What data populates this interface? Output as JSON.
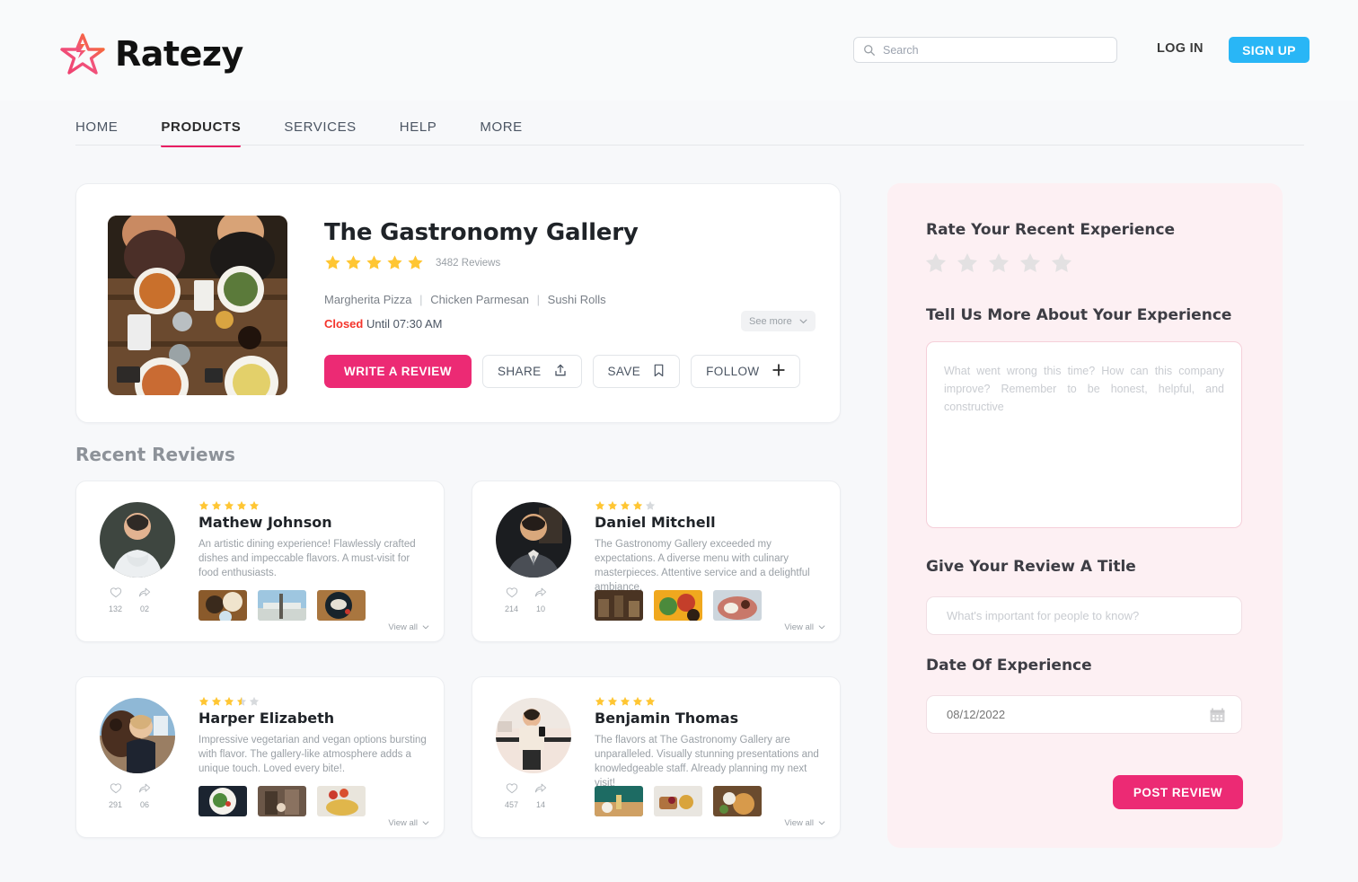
{
  "brand": {
    "name": "Ratezy",
    "accent_pink": "#ec2a74",
    "accent_blue": "#29b6f6",
    "star_yellow": "#ffc633"
  },
  "header": {
    "search_placeholder": "Search",
    "search_value": "",
    "login_label": "LOG IN",
    "signup_label": "SIGN UP"
  },
  "nav": {
    "items": [
      {
        "label": "HOME",
        "active": false
      },
      {
        "label": "PRODUCTS",
        "active": true
      },
      {
        "label": "SERVICES",
        "active": false
      },
      {
        "label": "HELP",
        "active": false
      },
      {
        "label": "MORE",
        "active": false
      }
    ]
  },
  "business": {
    "title": "The Gastronomy Gallery",
    "rating": 5,
    "reviews_count": "3482 Reviews",
    "tags": [
      "Margherita Pizza",
      "Chicken Parmesan",
      "Sushi Rolls"
    ],
    "status_label": "Closed",
    "status_detail": "Until 07:30 AM",
    "see_more_label": "See more",
    "actions": {
      "write_review": "WRITE A REVIEW",
      "share": "SHARE",
      "save": "SAVE",
      "follow": "FOLLOW"
    }
  },
  "reviews_section": {
    "title": "Recent Reviews",
    "view_all_label": "View all",
    "items": [
      {
        "name": "Mathew Johnson",
        "rating": 5,
        "text": "An artistic dining experience! Flawlessly crafted dishes and impeccable flavors. A must-visit for food enthusiasts.",
        "likes": "132",
        "shares": "02"
      },
      {
        "name": "Daniel Mitchell",
        "rating": 4,
        "text": "The Gastronomy Gallery exceeded my expectations. A diverse menu with culinary masterpieces. Attentive service and a delightful ambiance.",
        "likes": "214",
        "shares": "10"
      },
      {
        "name": "Harper Elizabeth",
        "rating": 3.5,
        "text": "Impressive vegetarian and vegan options bursting with flavor. The gallery-like atmosphere adds a unique touch. Loved every bite!.",
        "likes": "291",
        "shares": "06"
      },
      {
        "name": "Benjamin Thomas",
        "rating": 5,
        "text": "The flavors at The Gastronomy Gallery are unparalleled. Visually stunning presentations and knowledgeable staff. Already planning my next visit!",
        "likes": "457",
        "shares": "14"
      }
    ]
  },
  "review_form": {
    "rate_heading": "Rate Your Recent Experience",
    "rating_value": 0,
    "tell_heading": "Tell Us More About Your Experience",
    "textarea_placeholder": "What went wrong this time? How can this company improve? Remember to be honest, helpful, and constructive",
    "textarea_value": "",
    "title_heading": "Give Your Review A Title",
    "title_placeholder": "What's important for people to know?",
    "title_value": "",
    "date_heading": "Date Of Experience",
    "date_placeholder": "08/12/2022",
    "date_value": "",
    "submit_label": "POST REVIEW"
  }
}
